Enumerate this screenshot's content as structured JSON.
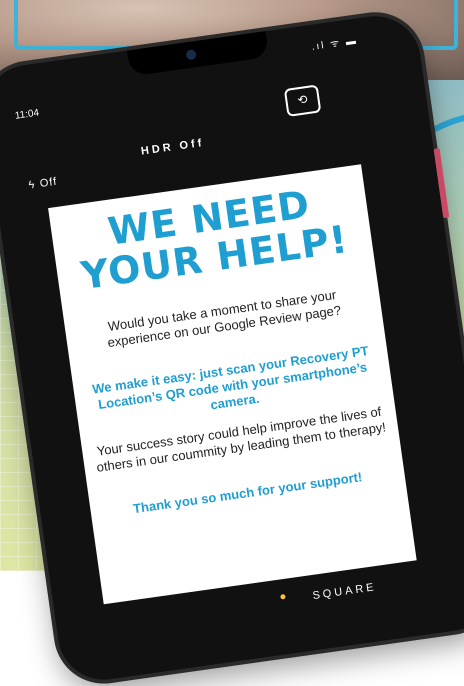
{
  "status": {
    "time": "11:04",
    "icons": ".ıl ᯤ ▬"
  },
  "camera": {
    "flash_label": "Off",
    "hdr_label": "HDR Off",
    "switch_icon": "⟲",
    "mode_label": "SQUARE"
  },
  "card": {
    "title_line1": "WE NEED",
    "title_line2": "YOUR HELP!",
    "paragraph1": "Would you take a moment to share your experience on our Google Review page?",
    "paragraph2": "We make it easy: just scan your Recovery PT Location’s QR code with your smartphone’s camera.",
    "paragraph3": "Your success story could help improve the lives of others in our coummity by leading them to therapy!",
    "paragraph4": "Thank you so much for your support!"
  },
  "colors": {
    "accent": "#1f9ed1",
    "phone": "#111111",
    "side_button": "#c94a63"
  }
}
